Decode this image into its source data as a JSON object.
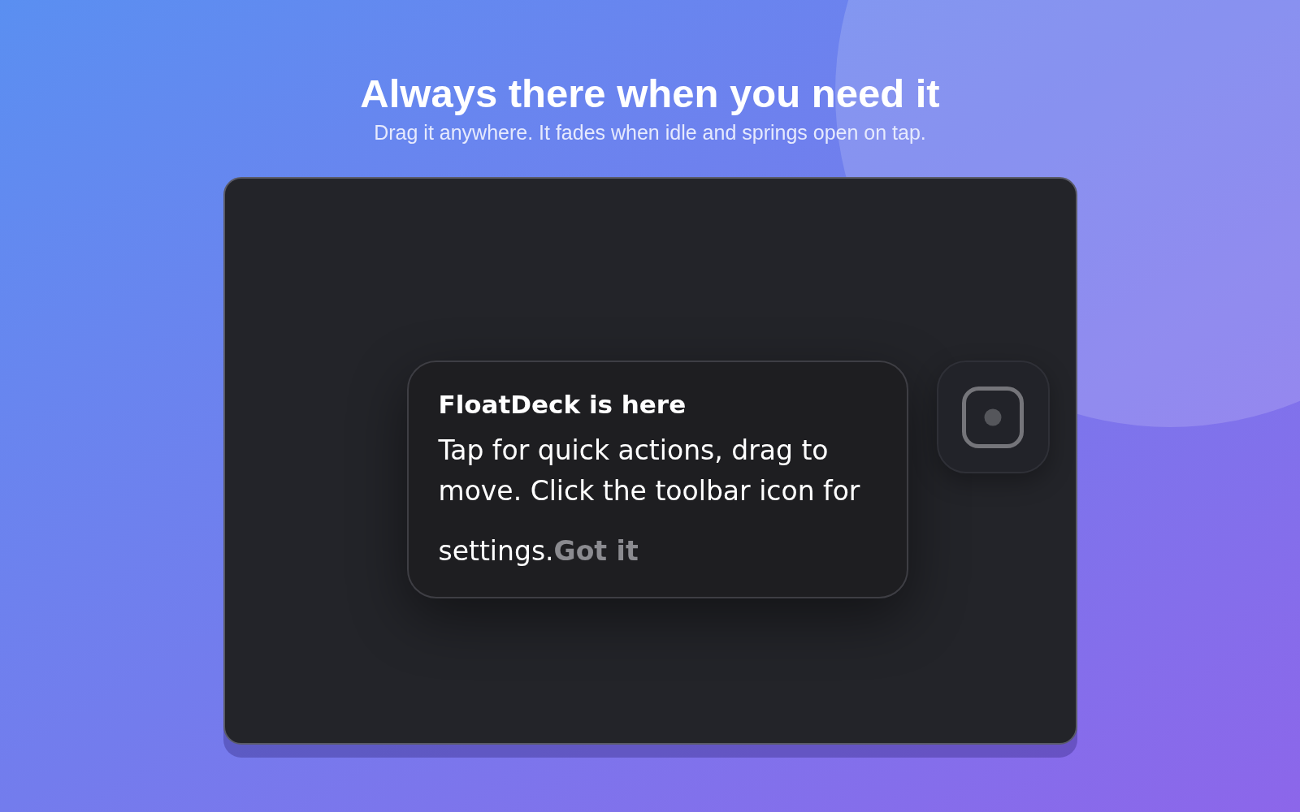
{
  "hero": {
    "title": "Always there when you need it",
    "subtitle": "Drag it anywhere. It fades when idle and springs open on tap."
  },
  "demo": {
    "tooltip": {
      "title": "FloatDeck is here",
      "body": "Tap for quick actions, drag to move. Click the toolbar icon for settings.",
      "action": "Got it"
    }
  }
}
